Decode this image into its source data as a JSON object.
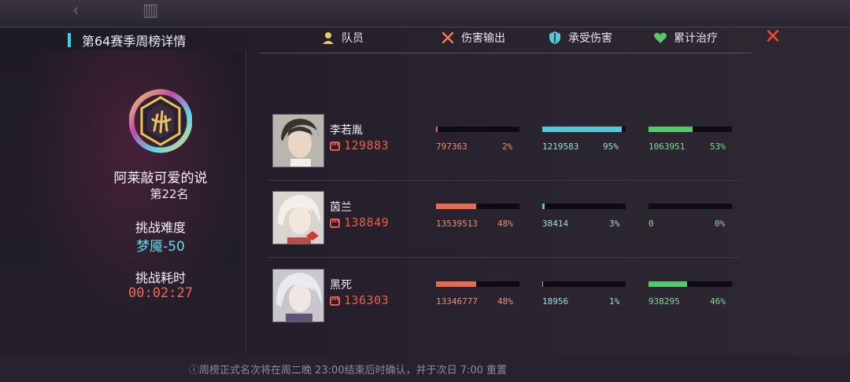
{
  "title": "第64赛季周榜详情",
  "hint": "ⓘ周榜正式名次将在周二晚 23:00结束后时确认，并于次日 7:00 重置",
  "player": {
    "name": "阿莱敲可爱的说",
    "rank": "第22名",
    "difficulty_label": "挑战难度",
    "difficulty_value": "梦魇-50",
    "time_label": "挑战耗时",
    "time_value": "00:02:27"
  },
  "columns": {
    "member": "队员",
    "damage": "伤害输出",
    "taken": "承受伤害",
    "heal": "累计治疗"
  },
  "icons": {
    "back": "back-chevron-icon",
    "home": "city-icon",
    "close": "close-x-icon",
    "member": "person-icon",
    "damage": "crossed-swords-icon",
    "taken": "shield-icon",
    "heal": "heart-icon",
    "power": "fist-icon"
  },
  "colors": {
    "accent": "#37d3e8",
    "close": "#f04a34",
    "damage": "#e66b52",
    "taken": "#55c7d6",
    "heal": "#54c96b",
    "power": "#ee5b4e"
  },
  "members": [
    {
      "name": "李若胤",
      "power": "129883",
      "damage": {
        "value": "797363",
        "percent": "2%",
        "ratio": 0.02
      },
      "taken": {
        "value": "1219583",
        "percent": "95%",
        "ratio": 0.95
      },
      "heal": {
        "value": "1063951",
        "percent": "53%",
        "ratio": 0.53
      }
    },
    {
      "name": "茵兰",
      "power": "138849",
      "damage": {
        "value": "13539513",
        "percent": "48%",
        "ratio": 0.48
      },
      "taken": {
        "value": "38414",
        "percent": "3%",
        "ratio": 0.03
      },
      "heal": {
        "value": "0",
        "percent": "0%",
        "ratio": 0.0
      }
    },
    {
      "name": "黑死",
      "power": "136303",
      "damage": {
        "value": "13346777",
        "percent": "48%",
        "ratio": 0.48
      },
      "taken": {
        "value": "18956",
        "percent": "1%",
        "ratio": 0.01
      },
      "heal": {
        "value": "938295",
        "percent": "46%",
        "ratio": 0.46
      }
    }
  ]
}
